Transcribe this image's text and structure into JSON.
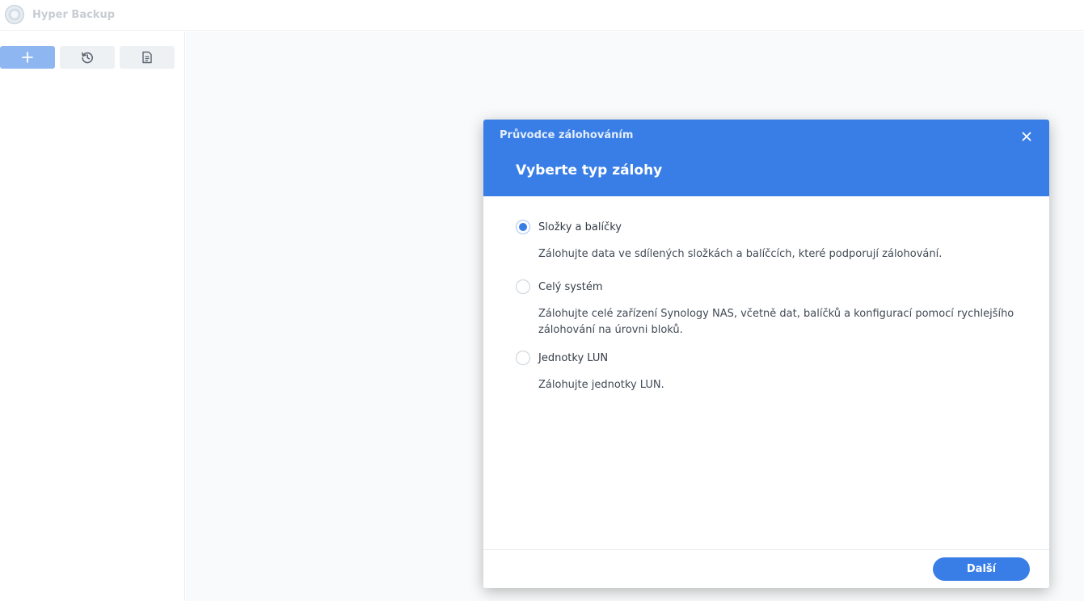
{
  "app": {
    "title": "Hyper Backup"
  },
  "toolbar": {
    "buttons": [
      {
        "icon": "plus-icon"
      },
      {
        "icon": "history-icon"
      },
      {
        "icon": "document-icon"
      }
    ]
  },
  "dialog": {
    "title": "Průvodce zálohováním",
    "heading": "Vyberte typ zálohy",
    "options": [
      {
        "label": "Složky a balíčky",
        "description": "Zálohujte data ve sdílených složkách a balíčcích, které podporují zálohování.",
        "selected": true
      },
      {
        "label": "Celý systém",
        "description": "Zálohujte celé zařízení Synology NAS, včetně dat, balíčků a konfigurací pomocí rychlejšího zálohování na úrovni bloků.",
        "selected": false
      },
      {
        "label": "Jednotky LUN",
        "description": "Zálohujte jednotky LUN.",
        "selected": false
      }
    ],
    "next_label": "Další"
  },
  "colors": {
    "accent": "#397ee6",
    "accent_light": "#8eb6f1",
    "main_bg": "#f8fafb"
  }
}
